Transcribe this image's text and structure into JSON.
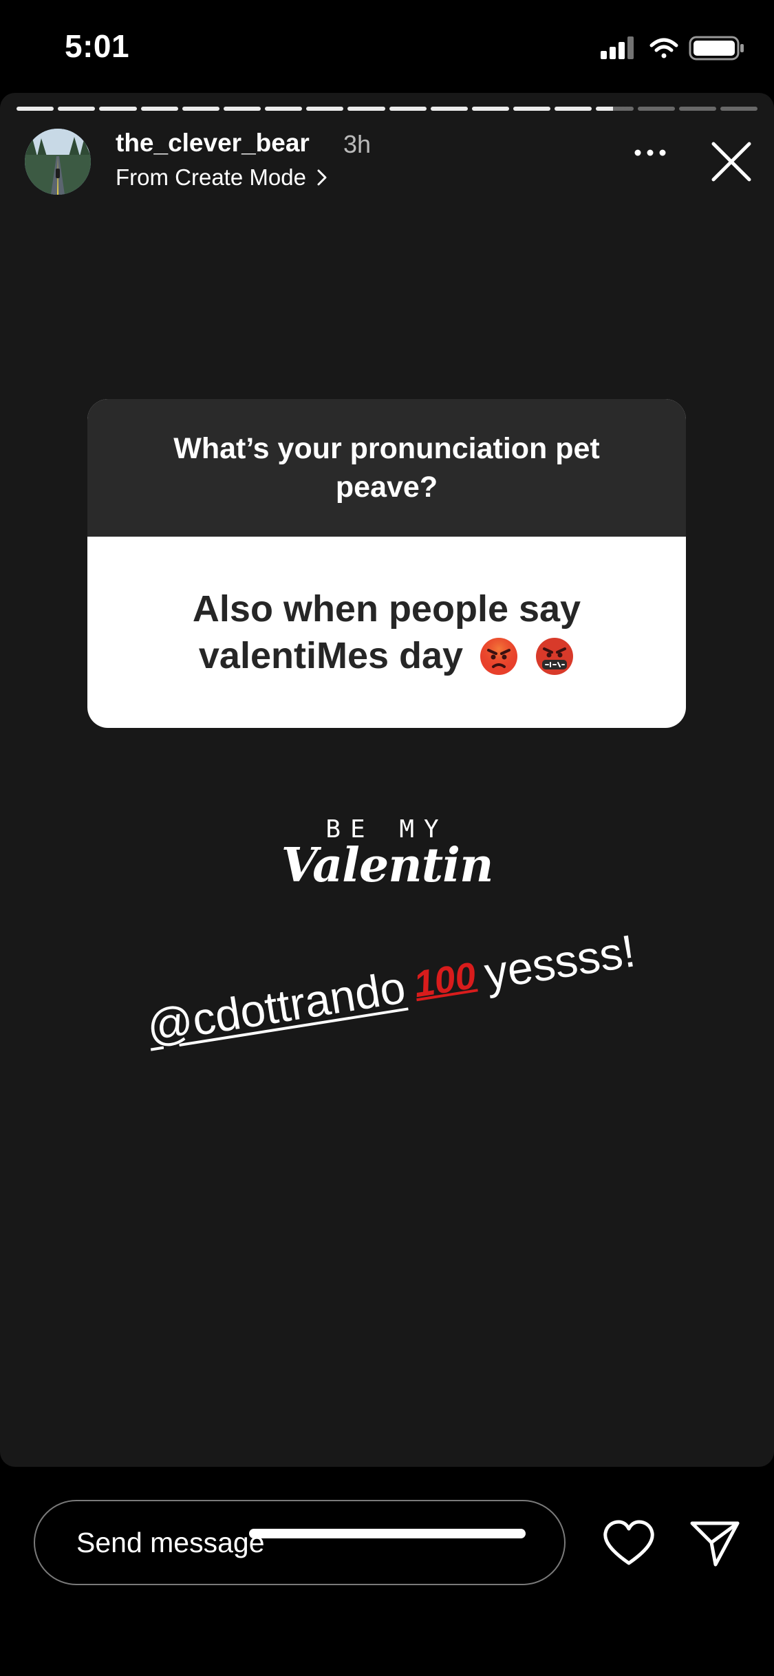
{
  "status_bar": {
    "time": "5:01",
    "icons": [
      "cellular-signal-icon",
      "wifi-icon",
      "battery-icon"
    ]
  },
  "story": {
    "progress": {
      "total_segments": 18,
      "completed_segments": 14,
      "current_fraction": 0.45
    },
    "username": "the_clever_bear",
    "time_ago": "3h",
    "subtitle": "From Create Mode",
    "question_sticker": {
      "question": "What’s your pronunciation pet peave?",
      "answer": "Also when people say valentiMes day",
      "answer_emojis": [
        "pouting-face-emoji",
        "face-with-symbols-on-mouth-emoji"
      ]
    },
    "be_my_sticker": {
      "top": "BE MY",
      "script": "Valentin"
    },
    "mention_text": {
      "handle": "@cdottrando",
      "emoji": "100",
      "suffix": "yessss!"
    }
  },
  "bottom_bar": {
    "message_placeholder": "Send message",
    "icons": [
      "heart-icon",
      "send-icon"
    ]
  },
  "colors": {
    "background": "#000000",
    "story_background": "#181818",
    "card_header": "#2a2a2a",
    "answer_text": "#262626",
    "hundred_red": "#d81c1c"
  }
}
